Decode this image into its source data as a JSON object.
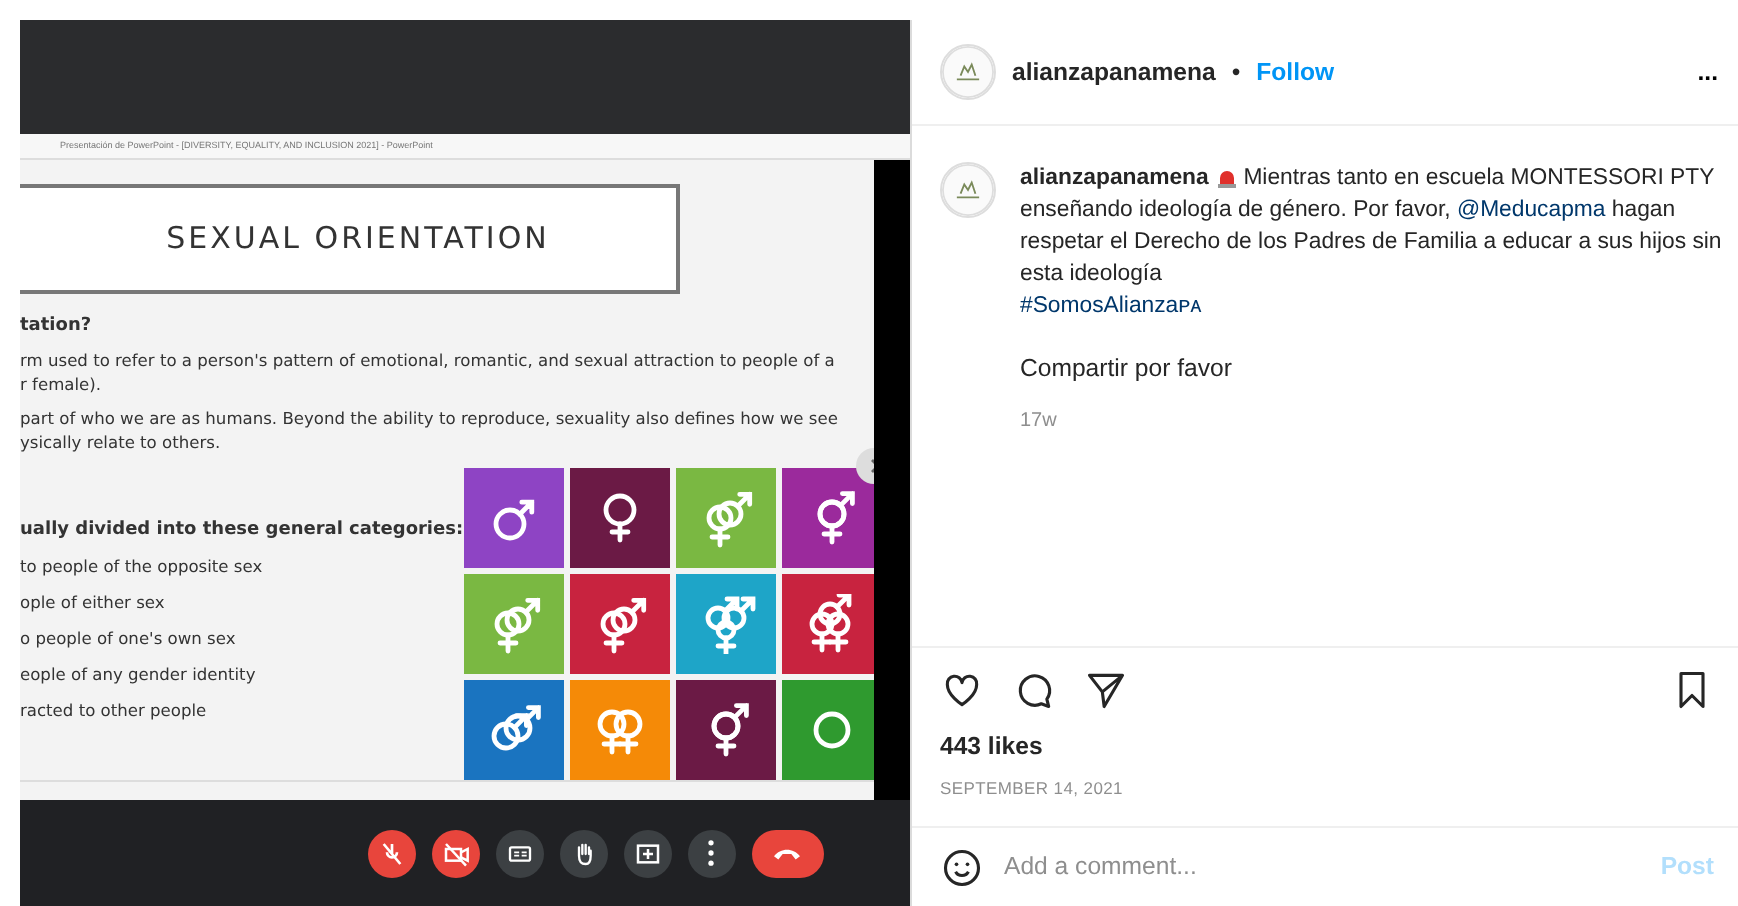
{
  "video_call": {
    "window_title": "Presentación de PowerPoint - [DIVERSITY, EQUALITY, AND INCLUSION 2021] - PowerPoint",
    "slide": {
      "title": "SEXUAL ORIENTATION",
      "intro": [
        {
          "kind": "heading",
          "text": "tation?"
        },
        {
          "kind": "para",
          "lines": [
            "rm used to refer to a person's pattern of emotional, romantic, and sexual attraction to people of a",
            "r female)."
          ]
        },
        {
          "kind": "para",
          "lines": [
            "part of who we are as humans. Beyond the ability to reproduce, sexuality also defines how we see",
            "ysically relate to others."
          ]
        }
      ],
      "categories_heading": "ually divided into these general categories:",
      "categories": [
        "to people of the opposite sex",
        "ople of either sex",
        "o people of one's own sex",
        "eople of any gender identity",
        "racted to other people"
      ],
      "tiles": [
        {
          "color": "#8e44c4",
          "kind": "male"
        },
        {
          "color": "#6b1a45",
          "kind": "female"
        },
        {
          "color": "#7ab842",
          "kind": "mixed-pair"
        },
        {
          "color": "#9b2a9c",
          "kind": "trans"
        },
        {
          "color": "#7ab842",
          "kind": "mixed-pair"
        },
        {
          "color": "#c8233f",
          "kind": "mixed-pair"
        },
        {
          "color": "#1ea5c8",
          "kind": "triple"
        },
        {
          "color": "#c8233f",
          "kind": "female-triple"
        },
        {
          "color": "#1a74c0",
          "kind": "male-pair"
        },
        {
          "color": "#f58a07",
          "kind": "female-pair"
        },
        {
          "color": "#6b1a45",
          "kind": "trans"
        },
        {
          "color": "#2f9a2f",
          "kind": "circle"
        }
      ]
    },
    "controls": [
      {
        "kind": "mic-off",
        "color": "#e8453c"
      },
      {
        "kind": "camera-off",
        "color": "#e8453c"
      },
      {
        "kind": "captions",
        "color": "#3c4043"
      },
      {
        "kind": "hand",
        "color": "#3c4043"
      },
      {
        "kind": "present",
        "color": "#3c4043"
      },
      {
        "kind": "more",
        "color": "#3c4043"
      },
      {
        "kind": "hang-up",
        "color": "#e8453c"
      }
    ]
  },
  "post": {
    "username": "alianzapanamena",
    "separator": "•",
    "follow": "Follow",
    "more": "...",
    "caption": [
      {
        "kind": "username",
        "text": "alianzapanamena"
      },
      {
        "kind": "alert"
      },
      {
        "kind": "text",
        "text": "Mientras tanto en escuela MONTESSORI PTY enseñando ideología de género. Por favor,"
      },
      {
        "kind": "mention",
        "text": "@Meducapma"
      },
      {
        "kind": "text",
        "text": "hagan respetar el Derecho de los Padres de Familia a educar a sus hijos sin esta ideología"
      }
    ],
    "hashtag": "#SomosAlianzaᴘᴀ",
    "note": "Compartir por favor",
    "age": "17w",
    "likes": "443 likes",
    "date": "SEPTEMBER 14, 2021",
    "comment_placeholder": "Add a comment...",
    "post_button": "Post"
  }
}
